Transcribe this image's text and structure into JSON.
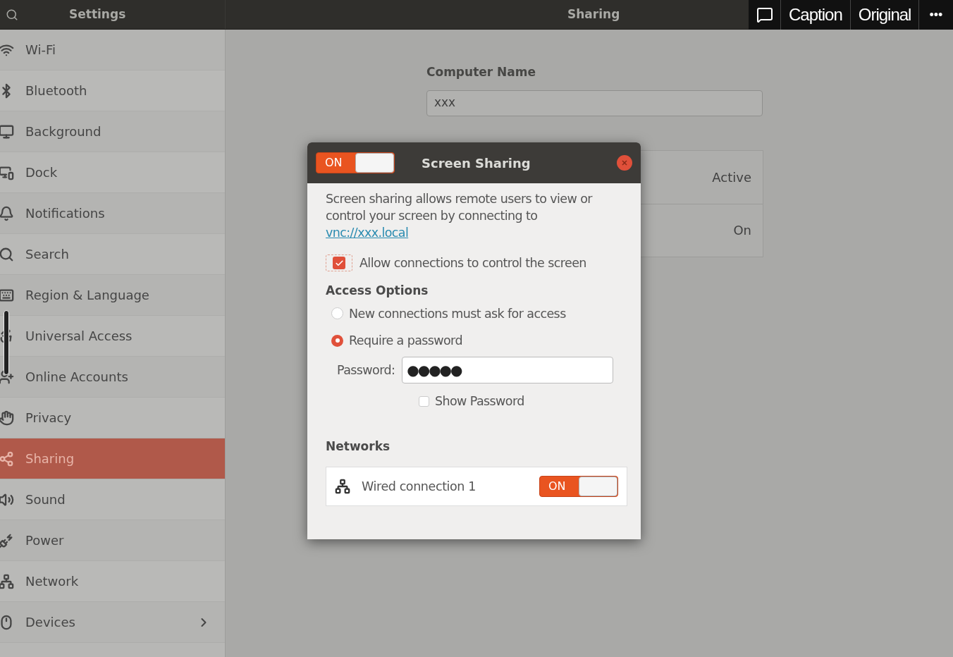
{
  "header": {
    "search_title": "Settings",
    "panel_title": "Sharing"
  },
  "overlay_toolbar": {
    "buttons": [
      "Caption",
      "Original"
    ],
    "more": "•••"
  },
  "sidebar": {
    "items": [
      {
        "label": "Wi-Fi",
        "selected": false
      },
      {
        "label": "Bluetooth",
        "selected": false
      },
      {
        "label": "Background",
        "selected": false
      },
      {
        "label": "Dock",
        "selected": false
      },
      {
        "label": "Notifications",
        "selected": false
      },
      {
        "label": "Search",
        "selected": false
      },
      {
        "label": "Region & Language",
        "selected": false
      },
      {
        "label": "Universal Access",
        "selected": false
      },
      {
        "label": "Online Accounts",
        "selected": false
      },
      {
        "label": "Privacy",
        "selected": false
      },
      {
        "label": "Sharing",
        "selected": true
      },
      {
        "label": "Sound",
        "selected": false
      },
      {
        "label": "Power",
        "selected": false
      },
      {
        "label": "Network",
        "selected": false
      },
      {
        "label": "Devices",
        "selected": false,
        "has_submenu": true
      }
    ]
  },
  "computer_name": {
    "label": "Computer Name",
    "value": "xxx"
  },
  "services": [
    {
      "status": "Active"
    },
    {
      "status": "On"
    }
  ],
  "dialog": {
    "title": "Screen Sharing",
    "switch": {
      "label": "ON",
      "on": true
    },
    "description": "Screen sharing allows remote users to view or control your screen by connecting to",
    "link": "vnc://xxx.local",
    "allow_control": {
      "label": "Allow connections to control the screen",
      "checked": true
    },
    "access_options": {
      "heading": "Access Options",
      "options": [
        {
          "label": "New connections must ask for access",
          "selected": false
        },
        {
          "label": "Require a password",
          "selected": true
        }
      ]
    },
    "password": {
      "label": "Password:",
      "value": "●●●●●"
    },
    "show_password": {
      "label": "Show Password",
      "checked": false
    },
    "networks": {
      "heading": "Networks",
      "items": [
        {
          "label": "Wired connection 1",
          "switch_label": "ON",
          "on": true
        }
      ]
    }
  }
}
